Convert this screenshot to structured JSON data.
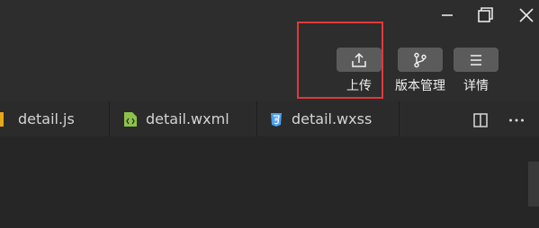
{
  "window_controls": {
    "minimize_icon": "minimize-icon",
    "restore_icon": "restore-icon",
    "close_icon": "close-icon"
  },
  "toolbar": {
    "upload": {
      "label": "上传",
      "icon": "upload-icon"
    },
    "version": {
      "label": "版本管理",
      "icon": "branch-icon"
    },
    "details": {
      "label": "详情",
      "icon": "menu-icon"
    }
  },
  "tabs": [
    {
      "label": "detail.js",
      "icon": "js-file-icon",
      "color": "#e8a81c"
    },
    {
      "label": "detail.wxml",
      "icon": "wxml-file-icon",
      "color": "#8bc34a"
    },
    {
      "label": "detail.wxss",
      "icon": "css3-file-icon",
      "color": "#4a9ff0"
    }
  ],
  "tab_actions": {
    "split": "split-editor-icon",
    "more": "more-icon"
  },
  "colors": {
    "highlight": "#e03a3a",
    "button_bg": "#5b5b5b",
    "background": "#2d2d2d"
  }
}
